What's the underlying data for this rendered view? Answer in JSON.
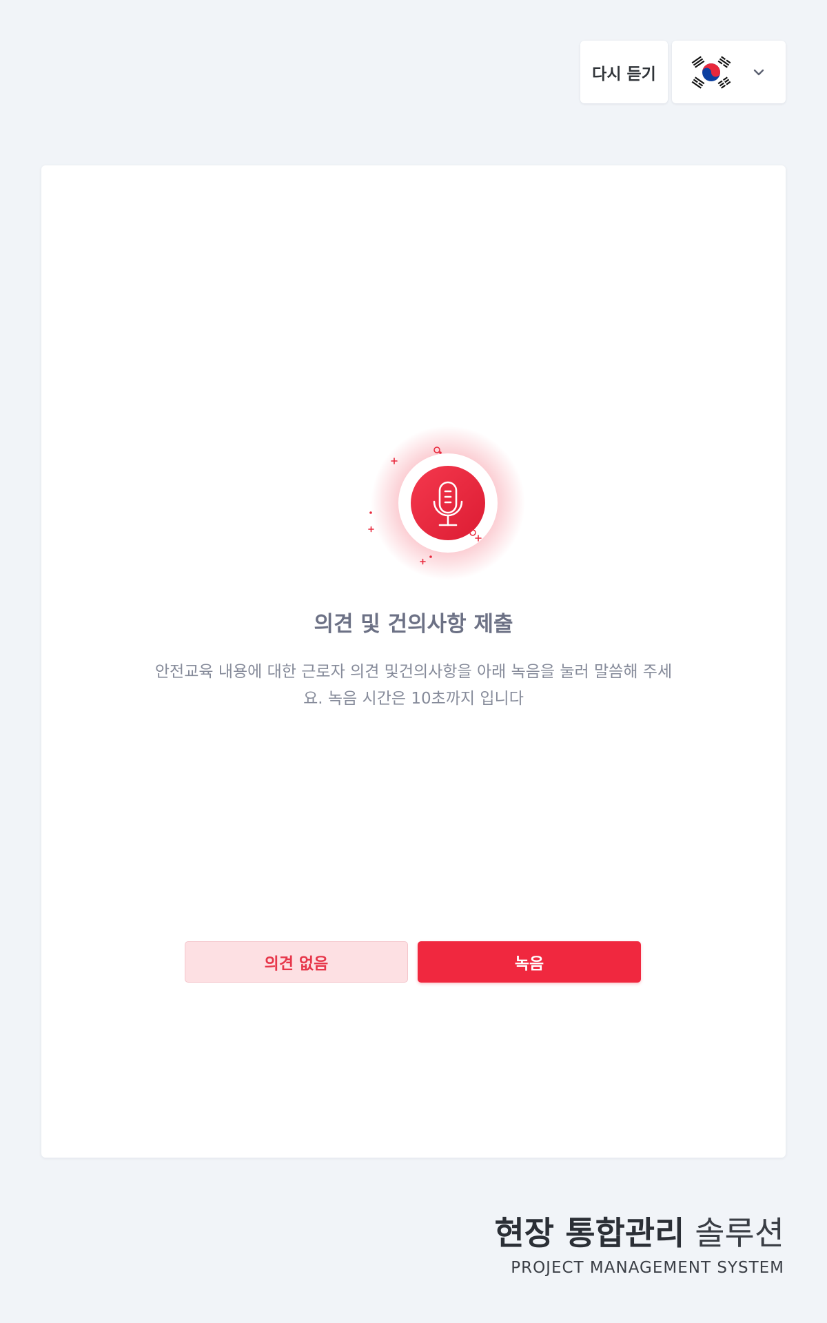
{
  "header": {
    "replay_label": "다시 듣기",
    "language": {
      "selected_icon": "korea-flag-icon",
      "dropdown_icon": "chevron-down-icon"
    }
  },
  "main": {
    "icon": "microphone-icon",
    "title": "의견 및 건의사항 제출",
    "description": "안전교육 내용에 대한 근로자 의견 및건의사항을 아래 녹음을 눌러 말씀해 주세요. 녹음 시간은 10초까지 입니다",
    "buttons": {
      "no_opinion_label": "의견 없음",
      "record_label": "녹음"
    }
  },
  "footer": {
    "brand_strong": "현장 통합관리",
    "brand_light": "솔루션",
    "brand_sub": "PROJECT MANAGEMENT SYSTEM"
  },
  "colors": {
    "accent": "#f0283f",
    "accent_soft": "#fde0e3",
    "background": "#f1f4f8",
    "title_text": "#6c7185",
    "body_text": "#868b9a"
  }
}
